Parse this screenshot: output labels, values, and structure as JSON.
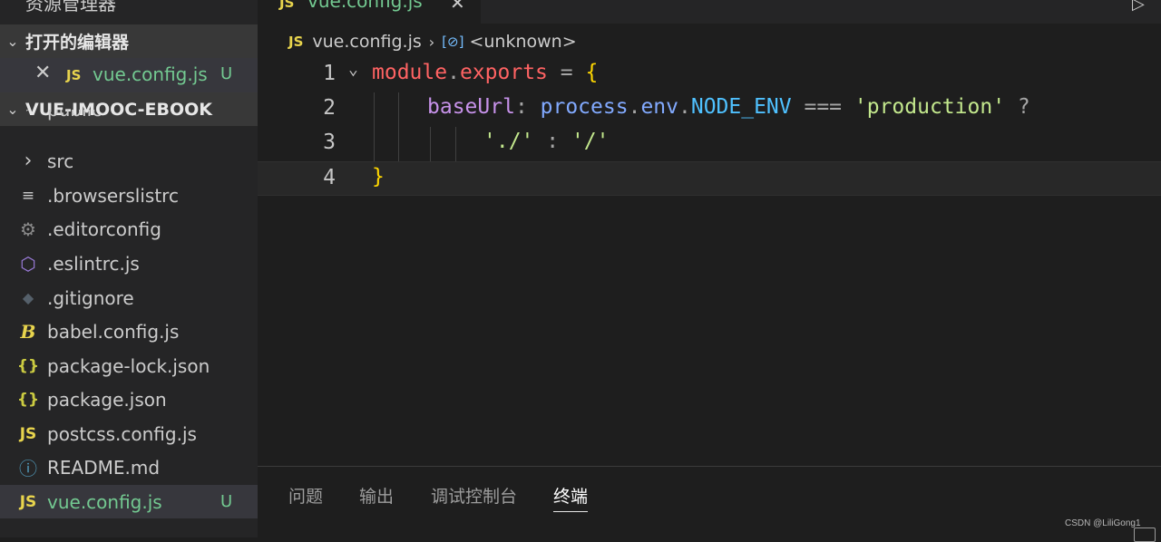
{
  "explorer": {
    "title": "资源管理器",
    "open_editors": {
      "header": "打开的编辑器",
      "items": [
        {
          "icon": "js",
          "name": "vue.config.js",
          "status": "U"
        }
      ]
    },
    "project": {
      "header": "VUE-IMOOC-EBOOK",
      "items": [
        {
          "icon": "chevron-right",
          "name": "public"
        },
        {
          "icon": "chevron-right",
          "name": "src"
        },
        {
          "icon": "lines",
          "name": ".browserslistrc"
        },
        {
          "icon": "gear",
          "name": ".editorconfig"
        },
        {
          "icon": "eslint",
          "name": ".eslintrc.js"
        },
        {
          "icon": "git",
          "name": ".gitignore"
        },
        {
          "icon": "babel",
          "name": "babel.config.js"
        },
        {
          "icon": "braces",
          "name": "package-lock.json"
        },
        {
          "icon": "braces",
          "name": "package.json"
        },
        {
          "icon": "js",
          "name": "postcss.config.js"
        },
        {
          "icon": "info",
          "name": "README.md"
        },
        {
          "icon": "js",
          "name": "vue.config.js",
          "status": "U"
        }
      ]
    }
  },
  "tabs": [
    {
      "icon": "js",
      "label": "vue.config.js",
      "close": "✕"
    }
  ],
  "icon_labels": {
    "js": "JS",
    "braces": "{}",
    "collapse": "⌄"
  },
  "breadcrumb": {
    "file": "vue.config.js",
    "symbol": "<unknown>"
  },
  "editor": {
    "lines": [
      {
        "num": "1",
        "tokens": {
          "mod": "module",
          "dot": ".",
          "prop": "exports",
          "eq": " = ",
          "brace": "{"
        }
      },
      {
        "num": "2",
        "tokens": {
          "key": "baseUrl",
          "colon": ": ",
          "obj": "process",
          "d1": ".",
          "env": "env",
          "d2": ".",
          "const": "NODE_ENV",
          "op": " === ",
          "str": "'production'",
          "q": " ?"
        }
      },
      {
        "num": "3",
        "tokens": {
          "s1": "'./'",
          "colon": " : ",
          "s2": "'/'"
        }
      },
      {
        "num": "4",
        "tokens": {
          "brace": "}"
        }
      }
    ]
  },
  "panel": {
    "tabs": [
      "问题",
      "输出",
      "调试控制台",
      "终端"
    ],
    "active_tab": "终端"
  },
  "watermark": "CSDN @LiliGong1",
  "colors": {
    "added_file": "#73c991",
    "js_badge": "#e8d44d",
    "string": "#c3e88d",
    "keyword": "#ff6363",
    "bracket": "#ffd700"
  }
}
